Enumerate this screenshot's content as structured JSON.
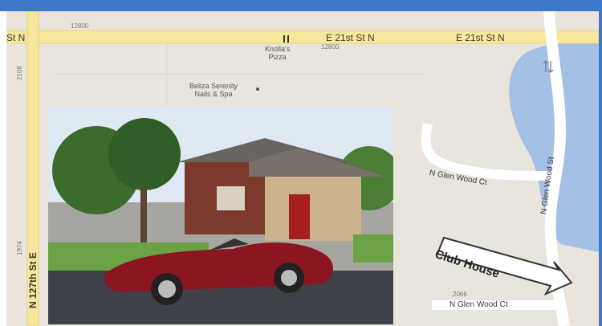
{
  "map": {
    "street_labels": {
      "top_left": "St N",
      "top_middle": "E 21st St N",
      "top_right": "E 21st St N",
      "left_vertical": "N 127th St E",
      "glen_wood_ct_upper": "N Glen Wood Ct",
      "glen_wood_st": "N Glen Wood St",
      "glen_wood_ct_lower": "N Glen Wood Ct"
    },
    "address_numbers": {
      "top_left": "12800",
      "top_middle": "12800",
      "left_upper": "2108",
      "left_lower": "1974",
      "bottom": "2066"
    },
    "pois": {
      "pizza_line1": "Knolla's",
      "pizza_line2": "Pizza",
      "spa_line1": "Beliza Serenity",
      "spa_line2": "Nails & Spa"
    },
    "callout": {
      "label": "Club House"
    },
    "colors": {
      "land": "#e9e5dc",
      "major_road": "#f6e79a",
      "minor_road": "#ffffff",
      "water": "#a4c0e4",
      "frame_accent": "#3d79c8"
    },
    "icons": [
      "restaurant-icon",
      "poi-dot-icon",
      "one-way-icon"
    ]
  }
}
